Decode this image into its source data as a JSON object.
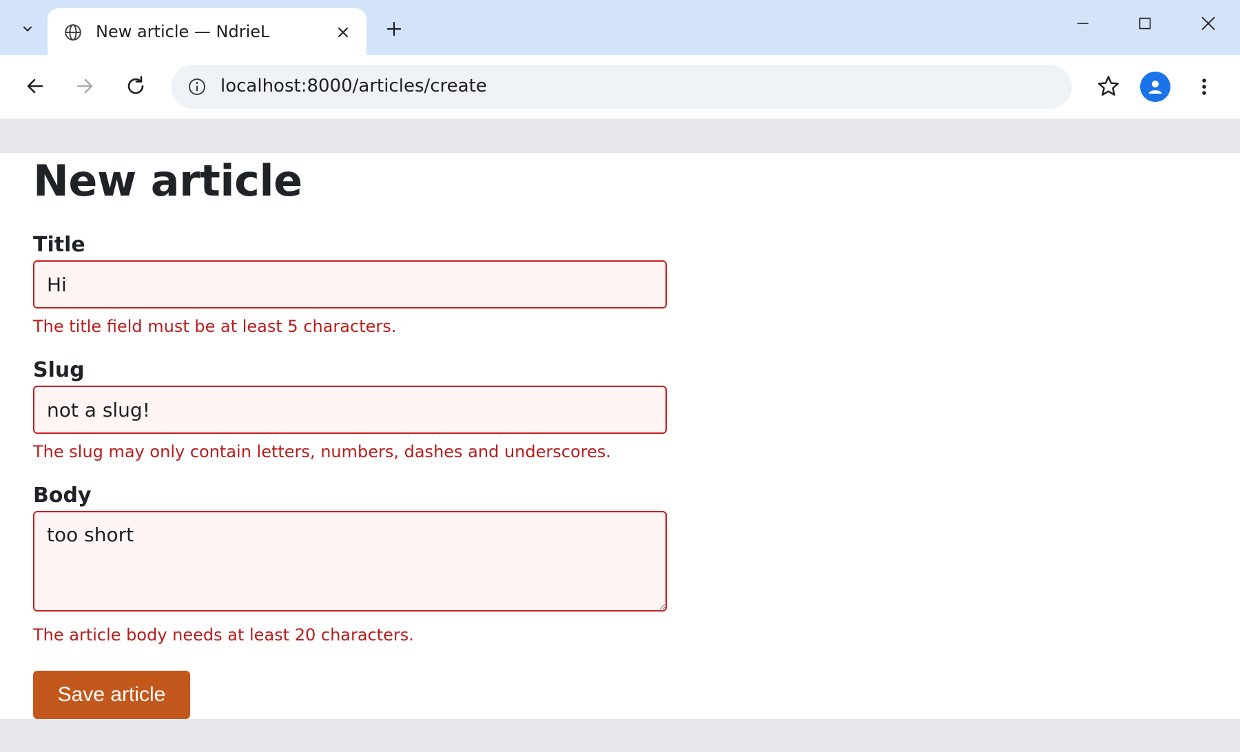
{
  "browser": {
    "tab": {
      "title": "New article — NdrieL",
      "favicon": "globe-icon"
    },
    "address_bar": {
      "url": "localhost:8000/articles/create"
    },
    "profile_color": "#1a73e8"
  },
  "page": {
    "heading": "New article",
    "fields": {
      "title": {
        "label": "Title",
        "value": "Hi",
        "error": "The title field must be at least 5 characters."
      },
      "slug": {
        "label": "Slug",
        "value": "not a slug!",
        "error": "The slug may only contain letters, numbers, dashes and underscores."
      },
      "body": {
        "label": "Body",
        "value": "too short",
        "error": "The article body needs at least 20 characters."
      }
    },
    "submit_label": "Save article"
  },
  "colors": {
    "error_text": "#b91c1c",
    "error_border": "#c81e1e",
    "error_bg": "#fff5f5",
    "button_bg": "#c2581b",
    "tabstrip_bg": "#d3e3f9"
  }
}
